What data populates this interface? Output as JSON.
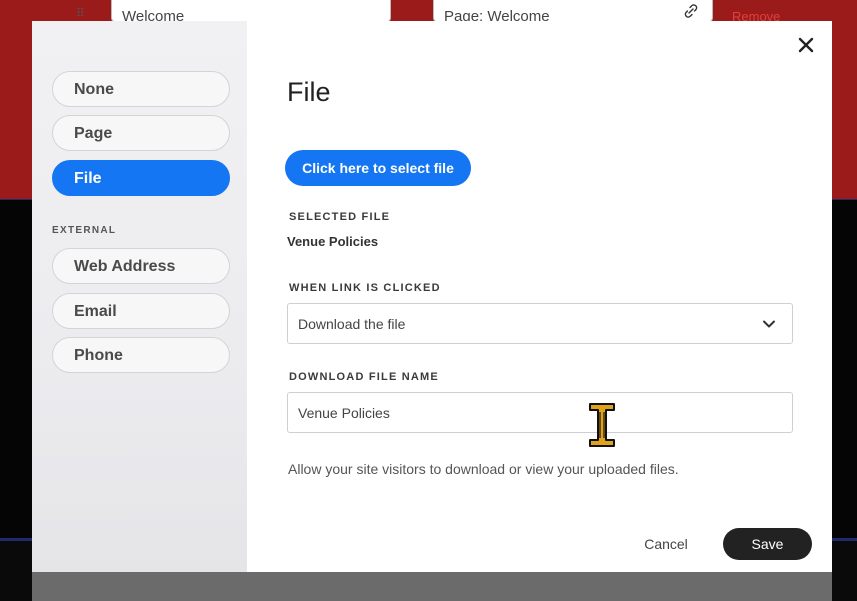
{
  "background": {
    "row_input_1": "Welcome",
    "row_input_2": "Page: Welcome",
    "remove_label": "Remove"
  },
  "sidebar": {
    "items": [
      {
        "label": "None",
        "active": false
      },
      {
        "label": "Page",
        "active": false
      },
      {
        "label": "File",
        "active": true
      }
    ],
    "external_label": "EXTERNAL",
    "external_items": [
      {
        "label": "Web Address"
      },
      {
        "label": "Email"
      },
      {
        "label": "Phone"
      }
    ]
  },
  "main": {
    "title": "File",
    "select_file_button": "Click here to select file",
    "selected_file_label": "SELECTED FILE",
    "selected_file_value": "Venue Policies",
    "when_clicked_label": "WHEN LINK IS CLICKED",
    "when_clicked_value": "Download the file",
    "download_name_label": "DOWNLOAD FILE NAME",
    "download_name_value": "Venue Policies",
    "help_text": "Allow your site visitors to download or view your uploaded files."
  },
  "footer": {
    "cancel_label": "Cancel",
    "save_label": "Save"
  },
  "colors": {
    "accent": "#1476f2",
    "save_bg": "#222222",
    "background_red": "#9b1b1b"
  },
  "icons": {
    "close": "close-icon",
    "chevron": "chevron-down-icon",
    "link": "link-icon",
    "cursor": "text-cursor-icon"
  }
}
